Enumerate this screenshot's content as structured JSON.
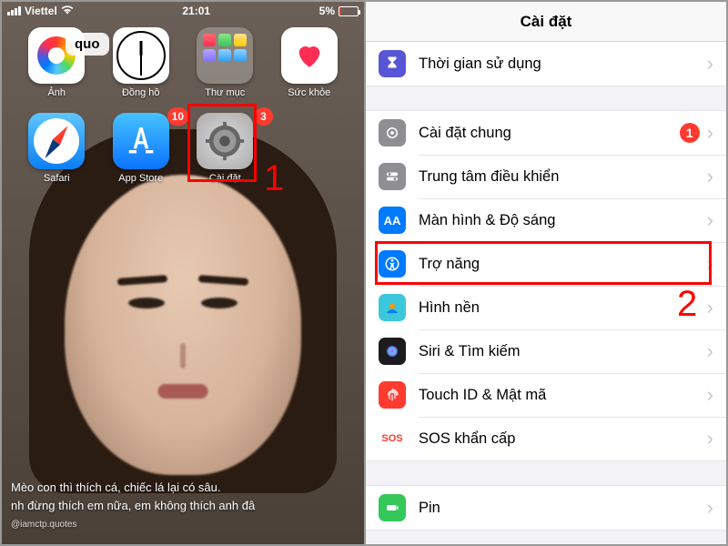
{
  "left": {
    "status": {
      "carrier": "Viettel",
      "wifi": "wifi-icon",
      "time": "21:01",
      "battery_pct": "5%"
    },
    "bubble_text": "quo",
    "apps_row1": [
      {
        "label": "Ảnh"
      },
      {
        "label": "Đồng hồ"
      },
      {
        "label": "Thư mục"
      },
      {
        "label": "Sức khỏe"
      }
    ],
    "apps_row2": [
      {
        "label": "Safari"
      },
      {
        "label": "App Store",
        "badge": "10"
      },
      {
        "label": "Cài đặt",
        "badge": "3"
      }
    ],
    "quote_line1": "Mèo con thì thích cá, chiếc lá lại có sâu.",
    "quote_line2": "nh đừng thích em nữa, em không thích anh đâ",
    "watermark": "@iamctp.quotes",
    "annotation1": "1"
  },
  "right": {
    "title": "Cài đặt",
    "rows": {
      "screentime": "Thời gian sử dụng",
      "general": "Cài đặt chung",
      "general_badge": "1",
      "cc": "Trung tâm điều khiển",
      "display": "Màn hình & Độ sáng",
      "access": "Trợ năng",
      "wallpaper": "Hình nền",
      "siri": "Siri & Tìm kiếm",
      "touchid": "Touch ID & Mật mã",
      "sos": "SOS khẩn cấp",
      "sos_icon_text": "SOS",
      "battery": "Pin"
    },
    "annotation2": "2"
  }
}
